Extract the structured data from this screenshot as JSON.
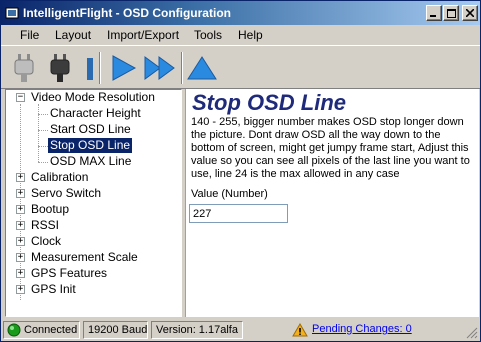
{
  "window": {
    "title": "IntelligentFlight - OSD Configuration"
  },
  "menu": [
    "File",
    "Layout",
    "Import/Export",
    "Tools",
    "Help"
  ],
  "toolbar": {
    "icons": [
      "disconnect-plug-icon",
      "connect-plug-icon",
      "play-icon",
      "fast-forward-icon",
      "upload-triangle-icon"
    ],
    "colors": {
      "arrow_blue": "#2a8ae0"
    }
  },
  "tree": {
    "items": [
      {
        "label": "Video Mode Resolution",
        "expanded": true,
        "children": [
          "Character Height",
          "Start OSD Line",
          "Stop OSD Line",
          "OSD MAX Line"
        ],
        "selected_child": "Stop OSD Line"
      },
      {
        "label": "Calibration",
        "expanded": false
      },
      {
        "label": "Servo Switch",
        "expanded": false
      },
      {
        "label": "Bootup",
        "expanded": false
      },
      {
        "label": "RSSI",
        "expanded": false
      },
      {
        "label": "Clock",
        "expanded": false
      },
      {
        "label": "Measurement Scale",
        "expanded": false
      },
      {
        "label": "GPS Features",
        "expanded": false
      },
      {
        "label": "GPS Init",
        "expanded": false
      }
    ]
  },
  "detail": {
    "title": "Stop OSD Line",
    "description": "140 - 255, bigger number makes OSD stop longer down the picture. Dont draw OSD all the way down to the bottom of screen, might get jumpy frame start, Adjust this value so you can see all pixels of the last line you want to use, line 24 is the max allowed in any case",
    "field_label": "Value (Number)",
    "field_value": "227",
    "title_color": "#1f2a7a"
  },
  "status": {
    "connection": "Connected",
    "baud": "19200 Baud",
    "version": "Version: 1.17alfa",
    "pending": "Pending Changes: 0",
    "connected_color": "#1a9a1a"
  }
}
